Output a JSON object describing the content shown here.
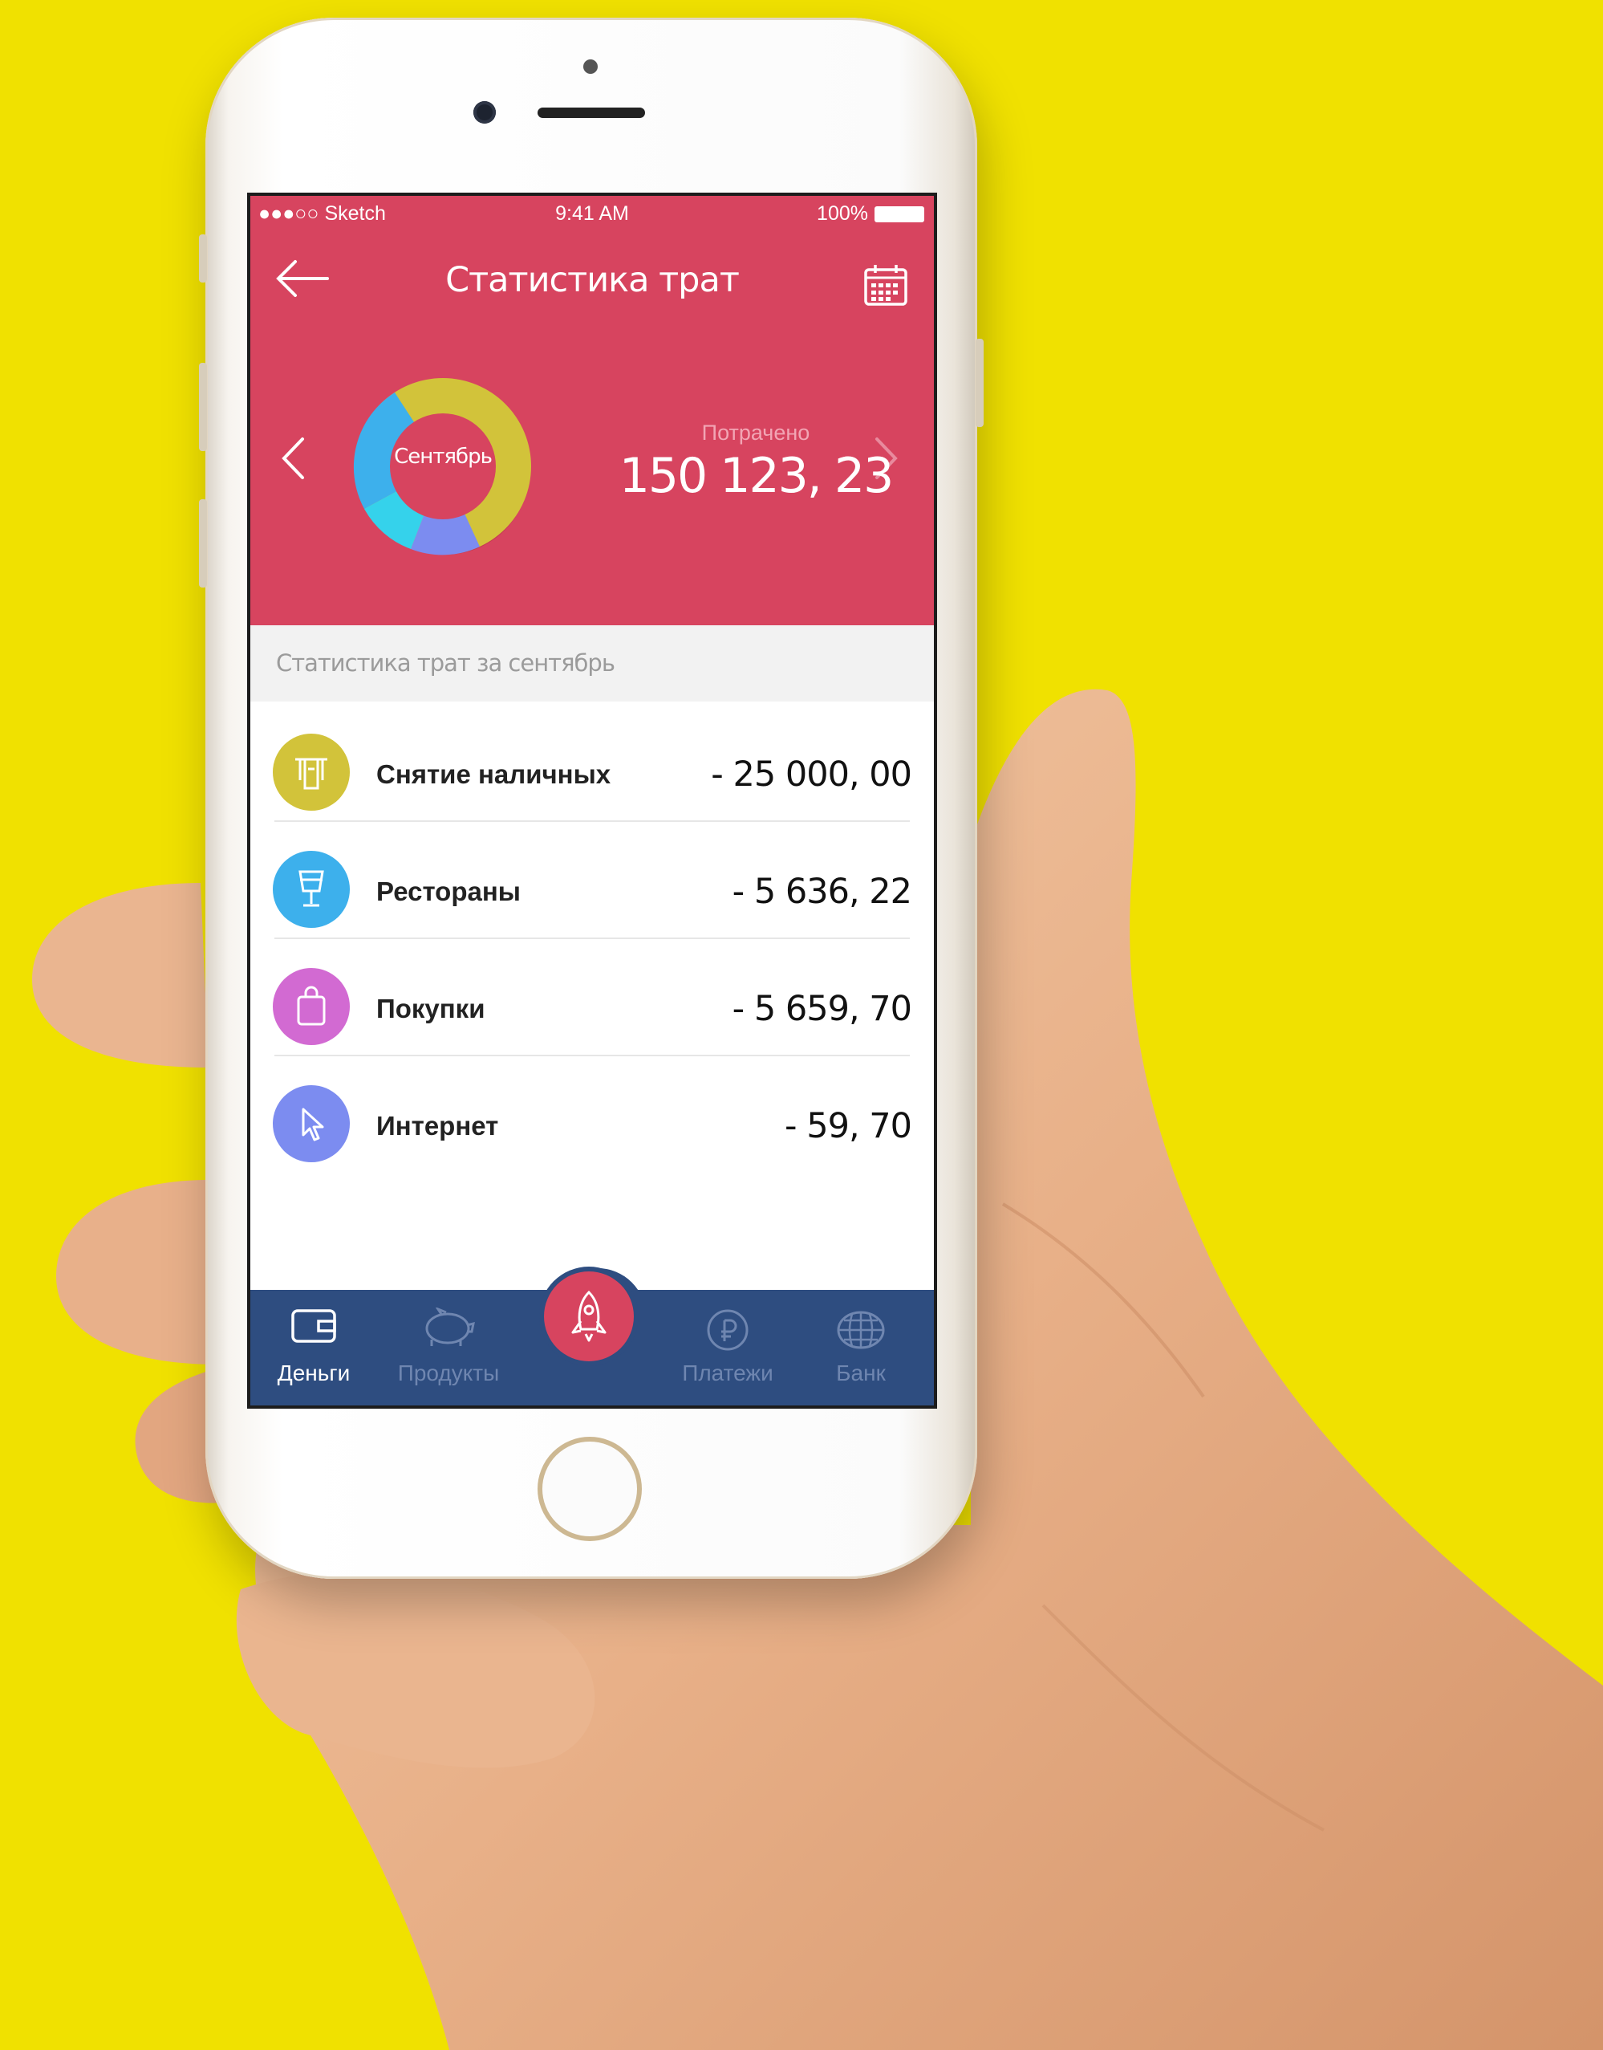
{
  "status_bar": {
    "carrier": "●●●○○ Sketch",
    "time": "9:41 AM",
    "battery": "100%"
  },
  "header": {
    "title": "Статистика трат"
  },
  "summary": {
    "month": "Сентябрь",
    "spent_label": "Потрачено",
    "spent_value": "150 123, 23"
  },
  "section": {
    "title": "Статистика трат за сентябрь"
  },
  "categories": [
    {
      "label": "Снятие наличных",
      "amount": "- 25 000, 00",
      "color": "#D2C33A",
      "icon": "cash-icon"
    },
    {
      "label": "Рестораны",
      "amount": "- 5 636, 22",
      "color": "#3DB0EC",
      "icon": "glass-icon"
    },
    {
      "label": "Покупки",
      "amount": "- 5 659, 70",
      "color": "#D26AD2",
      "icon": "shopping-bag-icon"
    },
    {
      "label": "Интернет",
      "amount": "- 59, 70",
      "color": "#7C8CF0",
      "icon": "cursor-icon"
    }
  ],
  "tabbar": {
    "tabs": [
      {
        "label": "Деньги",
        "icon": "wallet-icon",
        "active": true
      },
      {
        "label": "Продукты",
        "icon": "piggy-bank-icon",
        "active": false
      },
      {
        "label": "Платежи",
        "icon": "ruble-icon",
        "active": false
      },
      {
        "label": "Банк",
        "icon": "globe-icon",
        "active": false
      }
    ],
    "center_icon": "rocket-icon"
  },
  "colors": {
    "background": "#F0E100",
    "header": "#D7445F",
    "tabbar": "#2E4D80",
    "tab_active": "#FFFFFF",
    "tab_inactive": "#6F86B0"
  }
}
